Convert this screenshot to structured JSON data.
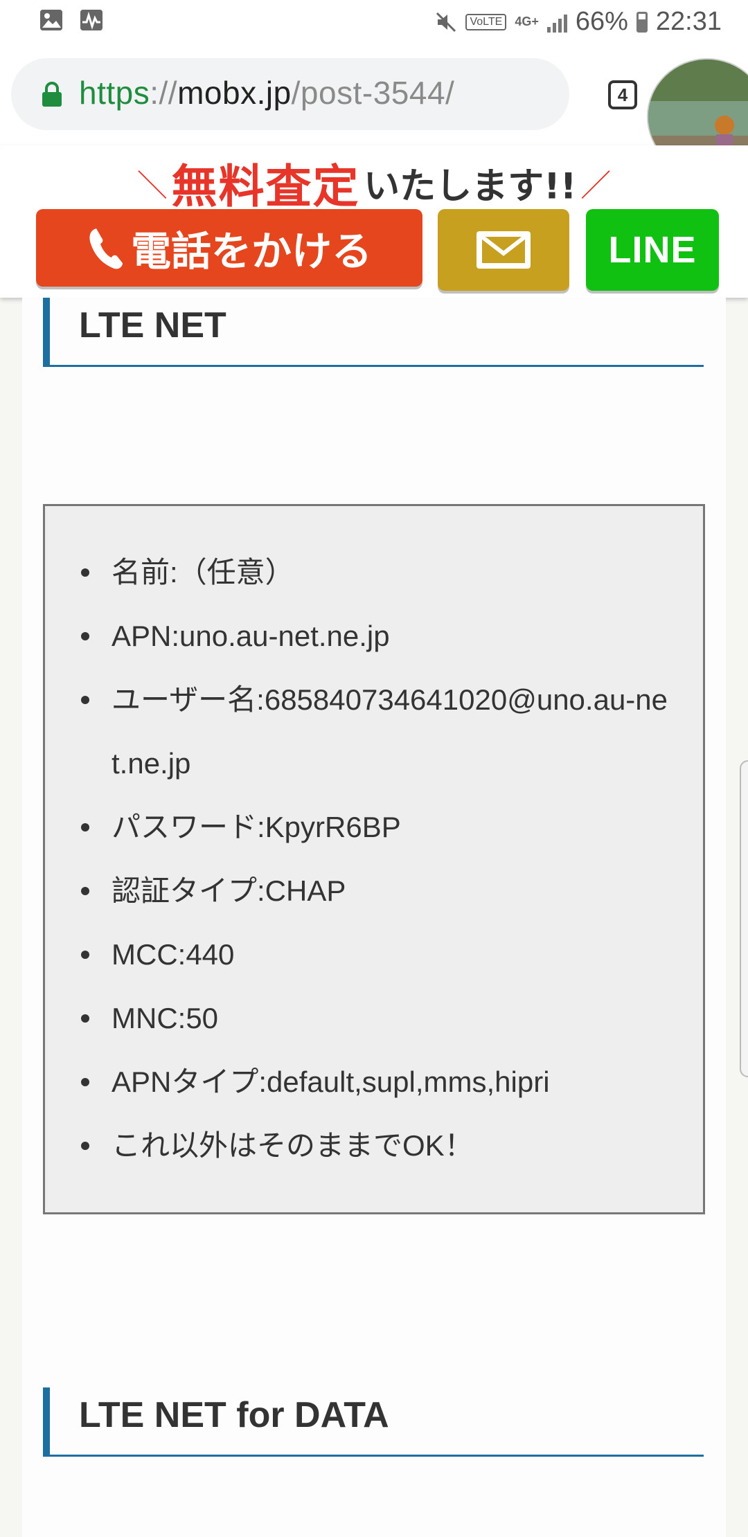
{
  "status_bar": {
    "battery": "66%",
    "time": "22:31",
    "network": "4G+",
    "volte": "VoLTE"
  },
  "browser": {
    "url_scheme": "https",
    "url_sep": "://",
    "url_host": "mobx.jp",
    "url_path": "/post-3544/",
    "tab_count": "4"
  },
  "banner": {
    "slash_left": "＼",
    "highlight": "無料査定",
    "rest": "いたします!!",
    "slash_right": "／",
    "phone_label": "電話をかける",
    "line_label": "LINE"
  },
  "colors": {
    "accent_blue": "#1e6fa1",
    "phone_button": "#e5461d",
    "mail_button": "#c8a020",
    "line_button": "#11c112",
    "url_green": "#1e8e3e"
  },
  "sections": [
    {
      "title": "LTE NET"
    },
    {
      "title": "LTE NET for DATA"
    }
  ],
  "apn_settings": [
    "名前:（任意）",
    "APN:uno.au-net.ne.jp",
    "ユーザー名:685840734641020@uno.au-net.ne.jp",
    "パスワード:KpyrR6BP",
    "認証タイプ:CHAP",
    "MCC:440",
    "MNC:50",
    "APNタイプ:default,supl,mms,hipri",
    "これ以外はそのままでOK！"
  ]
}
